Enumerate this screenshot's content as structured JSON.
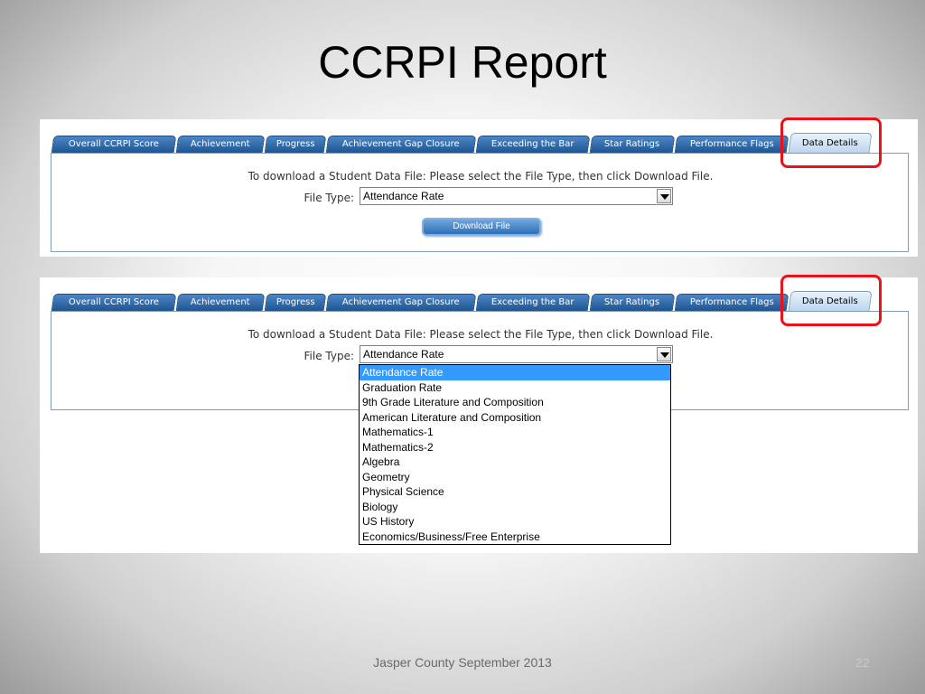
{
  "slide": {
    "title": "CCRPI Report",
    "footer": "Jasper County September 2013",
    "page_number": "22"
  },
  "tabs": [
    "Overall CCRPI Score",
    "Achievement",
    "Progress",
    "Achievement Gap Closure",
    "Exceeding the Bar",
    "Star Ratings",
    "Performance Flags",
    "Data Details"
  ],
  "active_tab": "Data Details",
  "form": {
    "instruction": "To download a Student Data File: Please select the File Type, then click Download File.",
    "file_type_label": "File Type:",
    "selected_value": "Attendance Rate",
    "download_label": "Download File"
  },
  "dropdown_options": [
    "Attendance Rate",
    "Graduation Rate",
    "9th Grade Literature and Composition",
    "American Literature and Composition",
    "Mathematics-1",
    "Mathematics-2",
    "Algebra",
    "Geometry",
    "Physical Science",
    "Biology",
    "US History",
    "Economics/Business/Free Enterprise"
  ],
  "colors": {
    "tab_blue": "#1e5591",
    "highlight_red": "#e8121b",
    "selected_option": "#3399ff"
  }
}
